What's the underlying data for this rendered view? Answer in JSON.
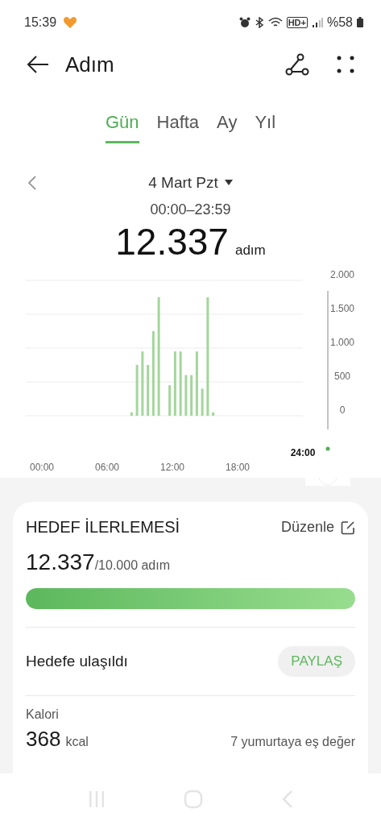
{
  "status_bar": {
    "time": "15:39",
    "network": "HD+",
    "battery": "%58"
  },
  "header": {
    "title": "Adım"
  },
  "tabs": [
    {
      "label": "Gün",
      "selected": true
    },
    {
      "label": "Hafta",
      "selected": false
    },
    {
      "label": "Ay",
      "selected": false
    },
    {
      "label": "Yıl",
      "selected": false
    }
  ],
  "day": {
    "date": "4 Mart Pzt",
    "range": "00:00–23:59",
    "total": "12.337",
    "unit": "adım"
  },
  "chart": {
    "cursor_label": "24:00",
    "chart_data": {
      "type": "bar",
      "x": [
        8,
        8.5,
        9,
        9.5,
        10,
        10.5,
        11.5,
        12,
        12.5,
        13,
        13.5,
        14,
        14.5,
        15,
        15.5
      ],
      "series": [
        {
          "color": "#a3d69b",
          "values": [
            50,
            750,
            950,
            750,
            1250,
            1750,
            450,
            950,
            950,
            600,
            600,
            950,
            400,
            1750,
            50
          ]
        }
      ],
      "xlim": [
        0,
        24
      ],
      "ylim": [
        0,
        2000
      ],
      "grid": true,
      "xticks": [
        {
          "value": 0,
          "label": "00:00"
        },
        {
          "value": 6,
          "label": "06:00"
        },
        {
          "value": 12,
          "label": "12:00"
        },
        {
          "value": 18,
          "label": "18:00"
        }
      ],
      "yticks": [
        {
          "value": 0,
          "label": "0"
        },
        {
          "value": 500,
          "label": "500"
        },
        {
          "value": 1000,
          "label": "1.000"
        },
        {
          "value": 1500,
          "label": "1.500"
        },
        {
          "value": 2000,
          "label": "2.000"
        }
      ]
    }
  },
  "goal": {
    "title": "HEDEF İLERLEMESİ",
    "edit": "Düzenle",
    "value": "12.337",
    "target": "/10.000 adım",
    "level": 1,
    "status": "Hedefe ulaşıldı",
    "share": "PAYLAŞ",
    "calorie_label": "Kalori",
    "calorie_value": "368",
    "calorie_unit": "kcal",
    "equivalent": "7 yumurtaya eş değer"
  }
}
